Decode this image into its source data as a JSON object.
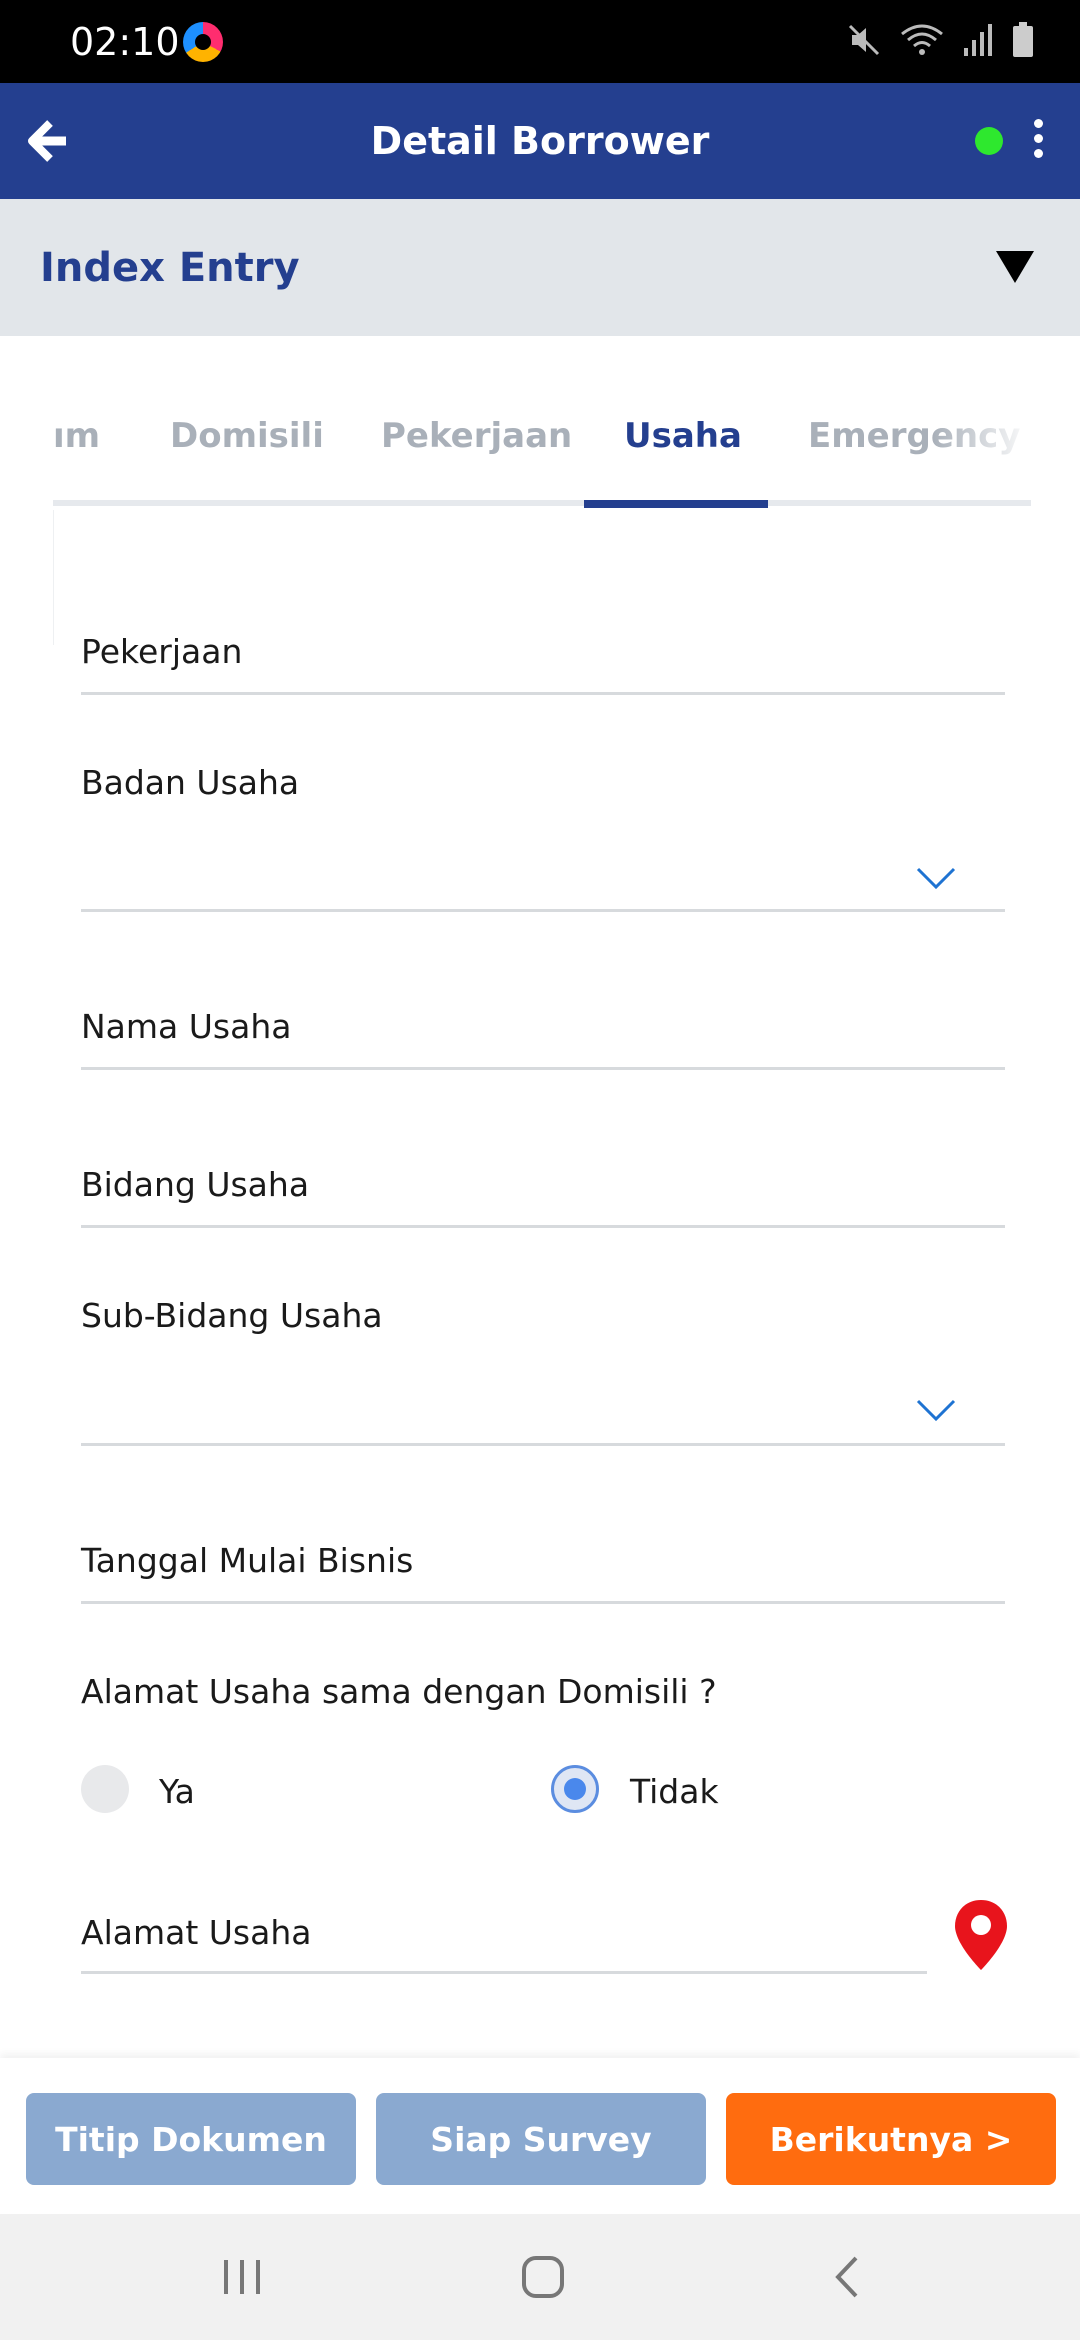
{
  "status_bar": {
    "time": "02:10",
    "icons": [
      "app-notification-icon",
      "mute-icon",
      "wifi-icon",
      "signal-icon",
      "battery-icon"
    ]
  },
  "app_bar": {
    "title": "Detail Borrower",
    "status_color": "#2ee82e",
    "background": "#243f8f"
  },
  "section": {
    "title": "Index Entry"
  },
  "tabs": [
    {
      "label": "ım",
      "active": false
    },
    {
      "label": "Domisili",
      "active": false
    },
    {
      "label": "Pekerjaan",
      "active": false
    },
    {
      "label": "Usaha",
      "active": true
    },
    {
      "label": "Emergency",
      "active": false
    }
  ],
  "form": {
    "pekerjaan": {
      "label": "Pekerjaan",
      "value": ""
    },
    "badan_usaha": {
      "label": "Badan Usaha",
      "value": ""
    },
    "nama_usaha": {
      "label": "Nama Usaha",
      "value": ""
    },
    "bidang_usaha": {
      "label": "Bidang Usaha",
      "value": ""
    },
    "sub_bidang_usaha": {
      "label": "Sub-Bidang Usaha",
      "value": ""
    },
    "tanggal_mulai_bisnis": {
      "label": "Tanggal Mulai Bisnis",
      "value": ""
    },
    "alamat_sama": {
      "question": "Alamat Usaha sama dengan Domisili ?",
      "options": [
        "Ya",
        "Tidak"
      ],
      "selected": "Tidak"
    },
    "alamat_usaha": {
      "label": "Alamat Usaha",
      "value": ""
    }
  },
  "actions": {
    "titip_dokumen": "Titip Dokumen",
    "siap_survey": "Siap Survey",
    "berikutnya": "Berikutnya >"
  },
  "colors": {
    "primary": "#243f8f",
    "accent": "#ff6c0f",
    "muted_button": "#8aa9d0",
    "radio_selected": "#4a88ec",
    "location_pin": "#e8141c"
  }
}
